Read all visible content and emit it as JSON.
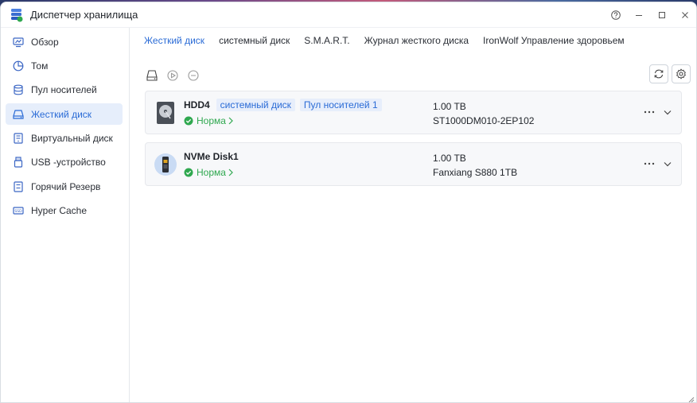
{
  "window": {
    "title": "Диспетчер хранилища"
  },
  "sidebar": {
    "items": [
      {
        "label": "Обзор",
        "icon": "overview-icon"
      },
      {
        "label": "Том",
        "icon": "volume-icon"
      },
      {
        "label": "Пул носителей",
        "icon": "storage-pool-icon"
      },
      {
        "label": "Жесткий диск",
        "icon": "hard-disk-icon",
        "active": true
      },
      {
        "label": "Виртуальный диск",
        "icon": "virtual-disk-icon"
      },
      {
        "label": "USB -устройство",
        "icon": "usb-icon"
      },
      {
        "label": "Горячий Резерв",
        "icon": "hot-spare-icon"
      },
      {
        "label": "Hyper Cache",
        "icon": "ssd-cache-icon"
      }
    ]
  },
  "tabs": [
    {
      "label": "Жесткий диск",
      "active": true
    },
    {
      "label": "системный диск"
    },
    {
      "label": "S.M.A.R.T."
    },
    {
      "label": "Журнал жесткого диска"
    },
    {
      "label": "IronWolf Управление здоровьем"
    }
  ],
  "disks": [
    {
      "name": "HDD4",
      "tags": [
        "системный диск",
        "Пул носителей 1"
      ],
      "status": "Норма",
      "capacity": "1.00 TB",
      "model": "ST1000DM010-2EP102",
      "thumb": "hdd-thumbnail-icon"
    },
    {
      "name": "NVMe Disk1",
      "tags": [],
      "status": "Норма",
      "capacity": "1.00 TB",
      "model": "Fanxiang S880 1TB",
      "thumb": "nvme-thumbnail-icon"
    }
  ],
  "colors": {
    "accent": "#2a6bd6",
    "ok": "#2fa84f",
    "active_bg": "#e6eefb"
  }
}
